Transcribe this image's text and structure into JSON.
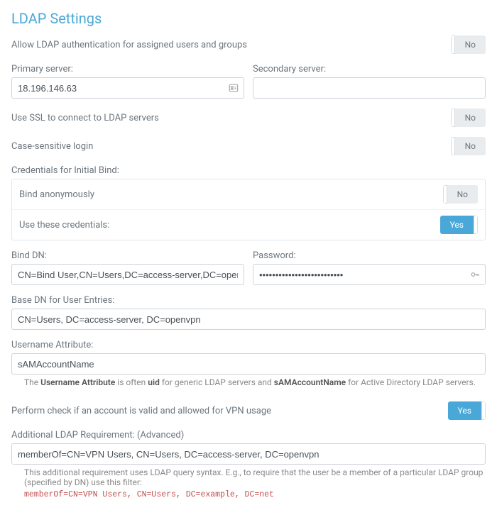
{
  "title": "LDAP Settings",
  "allow_ldap": {
    "label": "Allow LDAP authentication for assigned users and groups",
    "value": "No",
    "on": false
  },
  "servers": {
    "primary": {
      "label": "Primary server:",
      "value": "18.196.146.63"
    },
    "secondary": {
      "label": "Secondary server:",
      "value": ""
    }
  },
  "use_ssl": {
    "label": "Use SSL to connect to LDAP servers",
    "value": "No",
    "on": false
  },
  "case_sensitive": {
    "label": "Case-sensitive login",
    "value": "No",
    "on": false
  },
  "credentials_header": "Credentials for Initial Bind:",
  "bind_anon": {
    "label": "Bind anonymously",
    "value": "No",
    "on": false
  },
  "use_creds": {
    "label": "Use these credentials:",
    "value": "Yes",
    "on": true
  },
  "bind_dn": {
    "label": "Bind DN:",
    "value": "CN=Bind User,CN=Users,DC=access-server,DC=openvpn"
  },
  "password": {
    "label": "Password:",
    "value": "••••••••••••••••••••••••••"
  },
  "base_dn": {
    "label": "Base DN for User Entries:",
    "value": "CN=Users, DC=access-server, DC=openvpn"
  },
  "username_attr": {
    "label": "Username Attribute:",
    "value": "sAMAccountName"
  },
  "username_hint": {
    "prefix": "The ",
    "bold1": "Username Attribute",
    "mid": " is often ",
    "bold2": "uid",
    "mid2": " for generic LDAP servers and ",
    "bold3": "sAMAccountName",
    "suffix": " for Active Directory LDAP servers."
  },
  "perform_check": {
    "label": "Perform check if an account is valid and allowed for VPN usage",
    "value": "Yes",
    "on": true
  },
  "additional_req": {
    "label": "Additional LDAP Requirement: (Advanced)",
    "value": "memberOf=CN=VPN Users, CN=Users, DC=access-server, DC=openvpn"
  },
  "additional_hint": "This additional requirement uses LDAP query syntax. E.g., to require that the user be a member of a particular LDAP group (specified by DN) use this filter:",
  "additional_code": "memberOf=CN=VPN Users, CN=Users, DC=example, DC=net"
}
